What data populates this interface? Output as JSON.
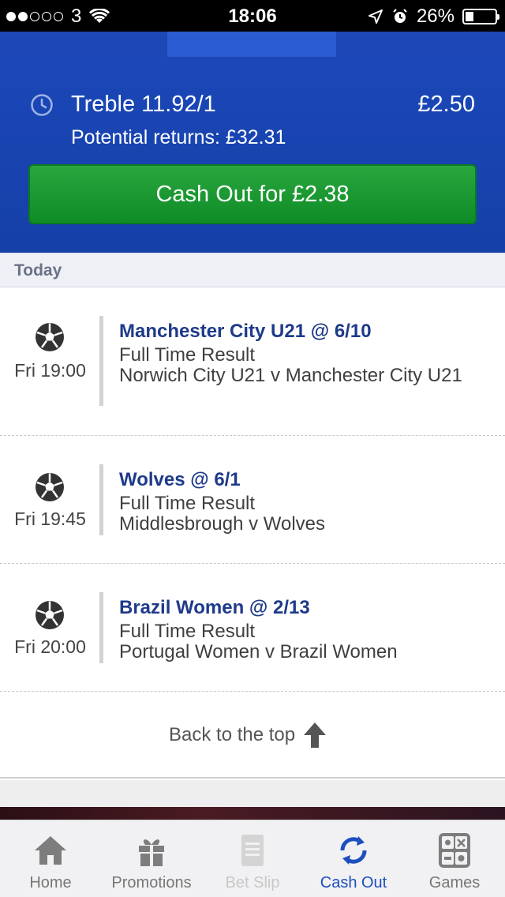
{
  "status_bar": {
    "carrier": "3",
    "time": "18:06",
    "battery": "26%",
    "battery_level": 0.26,
    "signal_bars_filled": 2,
    "signal_bars_total": 5
  },
  "bet": {
    "title": "Treble 11.92/1",
    "stake": "£2.50",
    "potential_returns": "Potential returns: £32.31",
    "cashout_label": "Cash Out for £2.38"
  },
  "section": {
    "label": "Today"
  },
  "selections": [
    {
      "pick": "Manchester City U21 @ 6/10",
      "market": "Full Time Result",
      "event": "Norwich City U21 v Manchester City U21",
      "time": "Fri 19:00",
      "icon": "football-icon"
    },
    {
      "pick": "Wolves @ 6/1",
      "market": "Full Time Result",
      "event": "Middlesbrough v Wolves",
      "time": "Fri 19:45",
      "icon": "football-icon"
    },
    {
      "pick": "Brazil Women @ 2/13",
      "market": "Full Time Result",
      "event": "Portugal Women v Brazil Women",
      "time": "Fri 20:00",
      "icon": "football-icon"
    }
  ],
  "back_to_top": {
    "label": "Back to the top",
    "icon": "arrow-up-icon"
  },
  "tab_bar": {
    "items": [
      {
        "label": "Home",
        "icon": "home-icon",
        "state": "normal"
      },
      {
        "label": "Promotions",
        "icon": "gift-icon",
        "state": "normal"
      },
      {
        "label": "Bet Slip",
        "icon": "betslip-icon",
        "state": "disabled"
      },
      {
        "label": "Cash Out",
        "icon": "cashout-icon",
        "state": "active"
      },
      {
        "label": "Games",
        "icon": "games-icon",
        "state": "normal"
      }
    ]
  },
  "colors": {
    "header_blue": "#1b47b8",
    "cashout_green": "#14922b",
    "pick_navy": "#1e3a8a",
    "active_tab": "#1e4fbf"
  }
}
